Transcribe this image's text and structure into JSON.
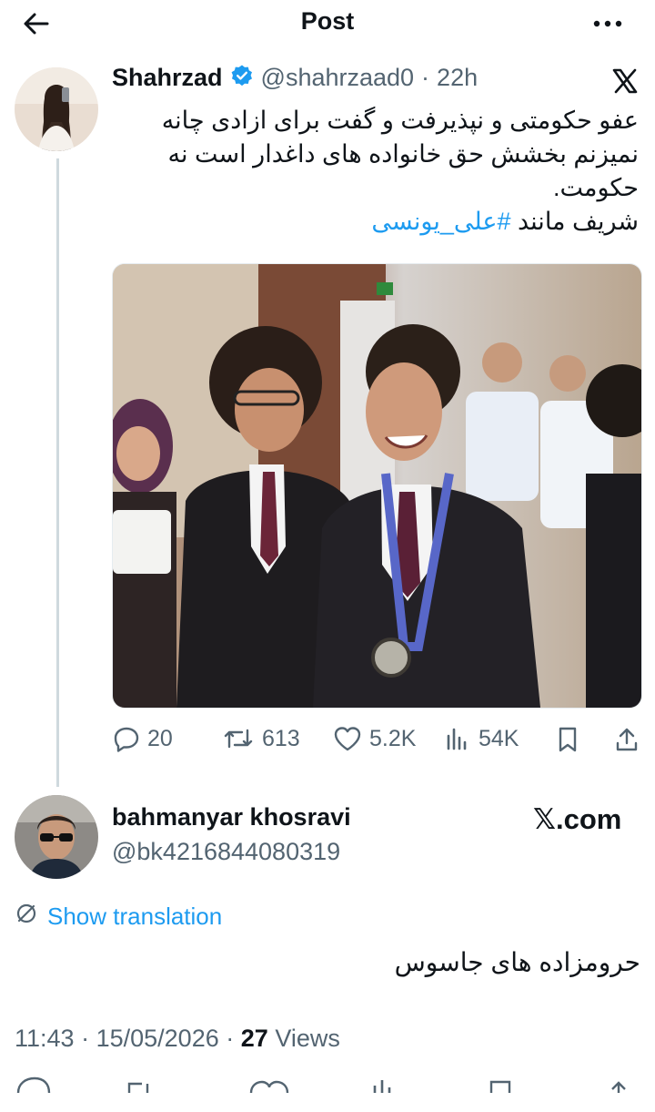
{
  "header": {
    "title": "Post"
  },
  "tweet": {
    "author_name": "Shahrzad",
    "handle": "@shahrzaad0",
    "separator": "·",
    "time": "22h",
    "text_line1": "عفو حکومتی و نپذیرفت و گفت برای ازادی چانه",
    "text_line2": "نمیزنم بخشش حق خانواده های داغدار است نه",
    "text_line3": "حکومت.",
    "text_line4_prefix": "شریف مانند",
    "hashtag": "#علی_یونسی",
    "actions": {
      "replies": "20",
      "reposts": "613",
      "likes": "5.2K",
      "views": "54K"
    }
  },
  "reply": {
    "author_name": "bahmanyar khosravi",
    "handle": "@bk4216844080319",
    "brand": "𝕏.com",
    "translation_label": "Show translation",
    "text": "حرومزاده های جاسوس",
    "time": "11:43",
    "sep1": "·",
    "date": "15/05/2026",
    "sep2": "·",
    "views_count": "27",
    "views_label": "Views"
  },
  "colors": {
    "accent": "#1d9bf0",
    "muted": "#536471",
    "text": "#0f1419",
    "verified": "#1d9bf0"
  },
  "icons": [
    "back-arrow-icon",
    "more-icon",
    "verified-badge-icon",
    "x-logo-icon",
    "reply-icon",
    "repost-icon",
    "like-icon",
    "views-icon",
    "bookmark-icon",
    "share-icon",
    "translate-icon"
  ]
}
